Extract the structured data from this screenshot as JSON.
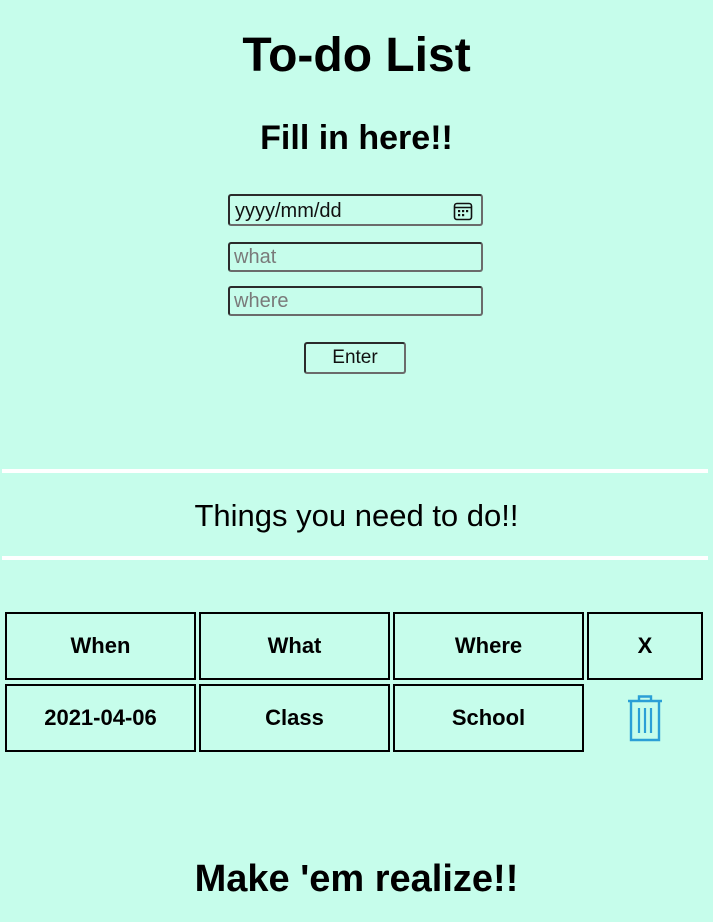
{
  "header": {
    "title": "To-do List",
    "subtitle": "Fill in here!!"
  },
  "form": {
    "date": {
      "value": "",
      "placeholder": "yyyy/mm/dd",
      "icon": "calendar-icon"
    },
    "what": {
      "value": "",
      "placeholder": "what"
    },
    "where": {
      "value": "",
      "placeholder": "where"
    },
    "enter_label": "Enter"
  },
  "list": {
    "heading": "Things you need to do!!",
    "columns": [
      "When",
      "What",
      "Where",
      "X"
    ],
    "rows": [
      {
        "when": "2021-04-06",
        "what": "Class",
        "where": "School",
        "action_icon": "trash-icon"
      }
    ]
  },
  "footer": {
    "text": "Make 'em realize!!"
  },
  "colors": {
    "background": "#c6fdeb",
    "divider": "#ffffff",
    "trash_icon": "#2b9fd6",
    "text": "#000000"
  }
}
